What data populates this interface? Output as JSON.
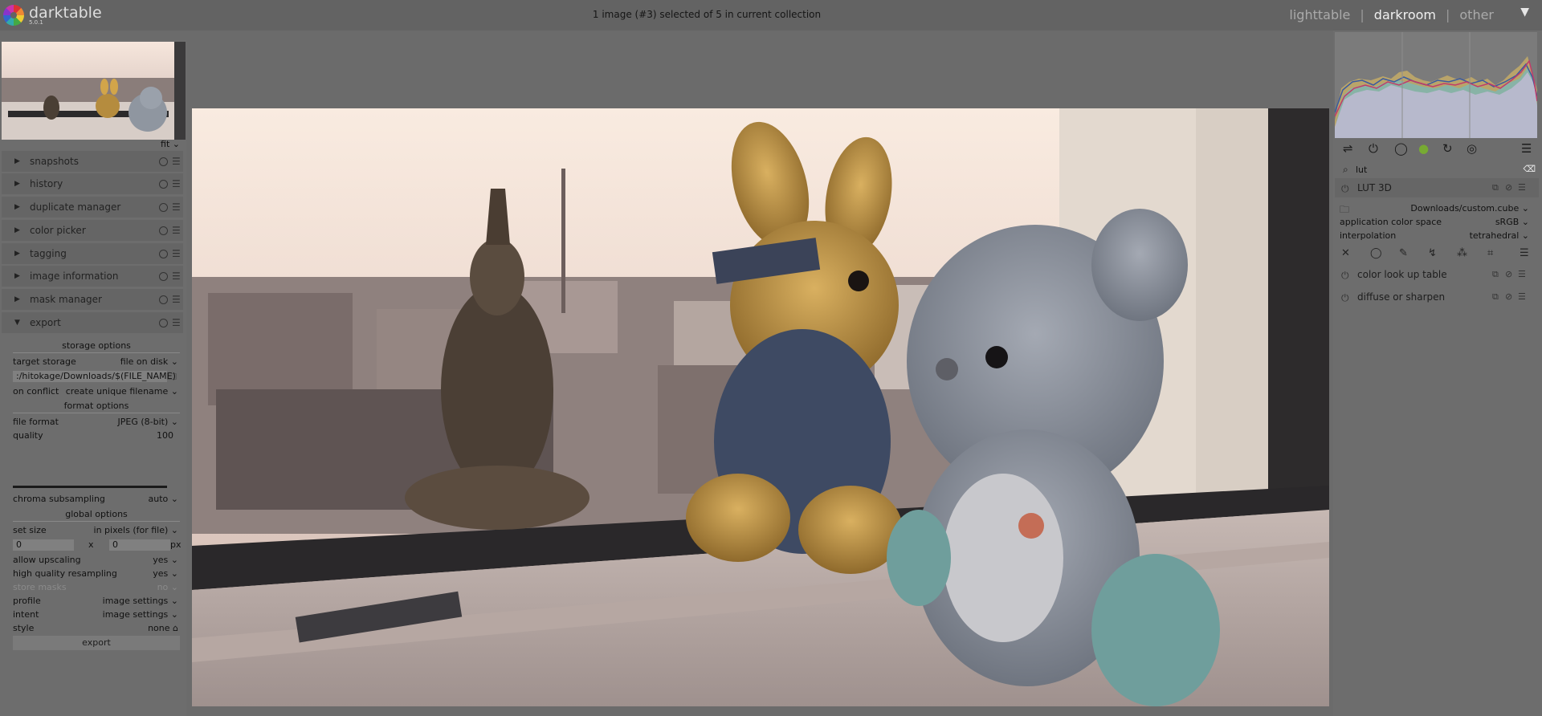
{
  "app": {
    "name": "darktable",
    "version": "5.0.1",
    "collection_info": "1 image (#3) selected of 5 in current collection"
  },
  "views": {
    "lighttable": "lighttable",
    "darkroom": "darkroom",
    "other": "other",
    "separator": "|"
  },
  "navigation": {
    "zoom": "fit"
  },
  "left_modules": [
    {
      "label": "snapshots",
      "expanded": false
    },
    {
      "label": "history",
      "expanded": false
    },
    {
      "label": "duplicate manager",
      "expanded": false
    },
    {
      "label": "color picker",
      "expanded": false
    },
    {
      "label": "tagging",
      "expanded": false
    },
    {
      "label": "image information",
      "expanded": false
    },
    {
      "label": "mask manager",
      "expanded": false
    },
    {
      "label": "export",
      "expanded": true
    }
  ],
  "export": {
    "storage_options": "storage options",
    "target_storage_label": "target storage",
    "target_storage_value": "file on disk",
    "path": ":/hitokage/Downloads/$(FILE_NAME)",
    "on_conflict_label": "on conflict",
    "on_conflict_value": "create unique filename",
    "format_options": "format options",
    "file_format_label": "file format",
    "file_format_value": "JPEG (8-bit)",
    "quality_label": "quality",
    "quality_value": "100",
    "chroma_label": "chroma subsampling",
    "chroma_value": "auto",
    "global_options": "global options",
    "set_size_label": "set size",
    "set_size_value": "in pixels (for file)",
    "width": "0",
    "height": "0",
    "size_x": "x",
    "size_unit": "px",
    "upscaling_label": "allow upscaling",
    "upscaling_value": "yes",
    "hq_label": "high quality resampling",
    "hq_value": "yes",
    "store_masks_label": "store masks",
    "store_masks_value": "no",
    "profile_label": "profile",
    "profile_value": "image settings",
    "intent_label": "intent",
    "intent_value": "image settings",
    "style_label": "style",
    "style_value": "none",
    "button": "export"
  },
  "right": {
    "search_value": "lut",
    "lut3d": {
      "name": "LUT 3D",
      "file": "Downloads/custom.cube",
      "app_cs_label": "application color space",
      "app_cs_value": "sRGB",
      "interp_label": "interpolation",
      "interp_value": "tetrahedral"
    },
    "modules": [
      {
        "name": "color look up table"
      },
      {
        "name": "diffuse or sharpen"
      }
    ]
  },
  "icons": {
    "dropdown": "chevron-down-icon",
    "folder": "folder-icon",
    "reset": "reset-icon",
    "presets": "presets-icon",
    "power": "power-icon"
  },
  "colors": {
    "topbar": "#636363",
    "panel": "#6d6d6d",
    "module_header": "#656565",
    "active_view": "#f0f0f0"
  }
}
